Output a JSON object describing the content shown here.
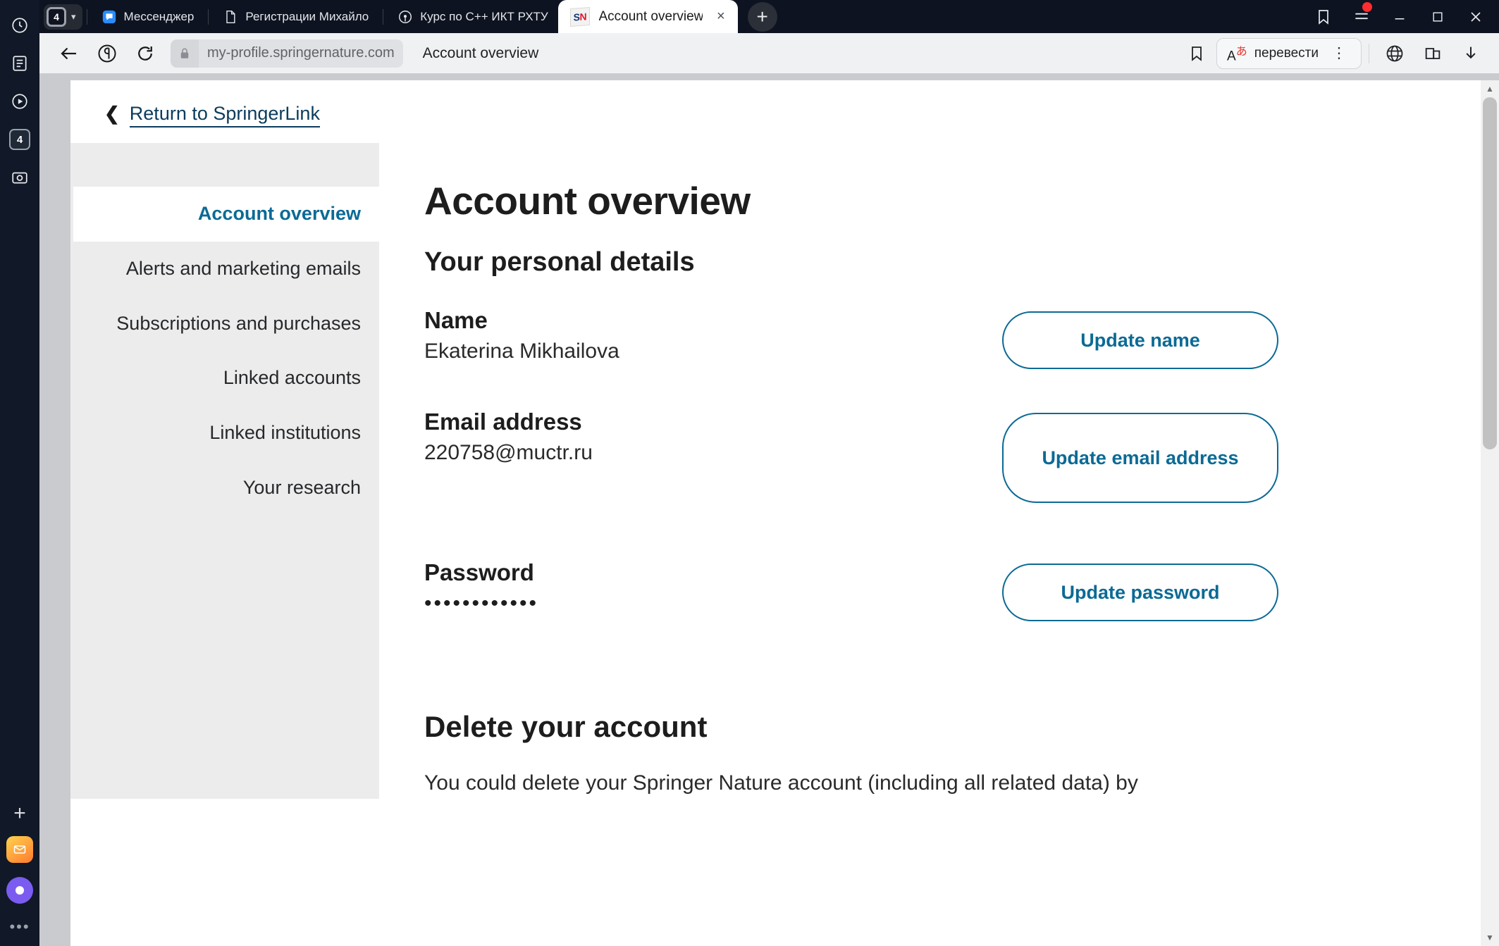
{
  "browser": {
    "rail": {
      "history_icon": "clock-icon",
      "tabgroup_count": "4",
      "reader_icon": "reader-icon",
      "video_icon": "play-icon",
      "badge_count": "4",
      "screenshot_icon": "camera-icon",
      "plus_icon": "plus-icon",
      "mail_icon": "mail-app-icon",
      "assistant_icon": "assistant-app-icon",
      "more_icon": "more-dots-icon"
    },
    "tabs": [
      {
        "title": "Мессенджер",
        "icon": "messenger-icon",
        "active": false
      },
      {
        "title": "Регистрации Михайло",
        "icon": "document-icon",
        "active": false
      },
      {
        "title": "Курс по С++ ИКТ РХТУ",
        "icon": "github-icon",
        "active": false
      },
      {
        "title": "Account overview",
        "icon": "springer-nature-favicon",
        "active": true
      }
    ],
    "tab_close_glyph": "×",
    "new_tab_label": "+",
    "window_controls": {
      "bookmark_icon": "bookmark-icon",
      "menu_icon": "hamburger-menu-icon",
      "minimize": "—",
      "maximize": "▢",
      "close": "✕"
    },
    "toolbar": {
      "back_icon": "back-arrow-icon",
      "yandex_icon": "yandex-logo-icon",
      "reload_icon": "reload-icon",
      "lock_icon": "lock-icon",
      "url": "my-profile.springernature.com",
      "page_title": "Account overview",
      "bookmark_icon": "bookmark-outline-icon",
      "translate_label": "перевести",
      "translate_icon": "translate-a-icon",
      "kebab_icon": "kebab-menu-icon",
      "globe_icon": "globe-icon",
      "collections_icon": "collections-icon",
      "download_icon": "download-icon"
    }
  },
  "page": {
    "return_link": "Return to SpringerLink",
    "return_chevron": "❮",
    "sidebar": {
      "items": [
        {
          "label": "Account overview",
          "active": true
        },
        {
          "label": "Alerts and marketing emails",
          "active": false
        },
        {
          "label": "Subscriptions and purchases",
          "active": false
        },
        {
          "label": "Linked accounts",
          "active": false
        },
        {
          "label": "Linked institutions",
          "active": false
        },
        {
          "label": "Your research",
          "active": false
        }
      ]
    },
    "heading": "Account overview",
    "personal_details_heading": "Your personal details",
    "fields": [
      {
        "label": "Name",
        "value": "Ekaterina Mikhailova",
        "button": "Update name"
      },
      {
        "label": "Email address",
        "value": "220758@muctr.ru",
        "button": "Update email address"
      },
      {
        "label": "Password",
        "value": "••••••••••••",
        "button": "Update password"
      }
    ],
    "delete_heading": "Delete your account",
    "delete_body": "You could delete your Springer Nature account (including all related data) by"
  },
  "colors": {
    "accent_blue": "#0b6a95",
    "link_navy": "#0b3c5d",
    "sidebar_bg": "#ececec",
    "chrome_dark": "#0d1320"
  }
}
